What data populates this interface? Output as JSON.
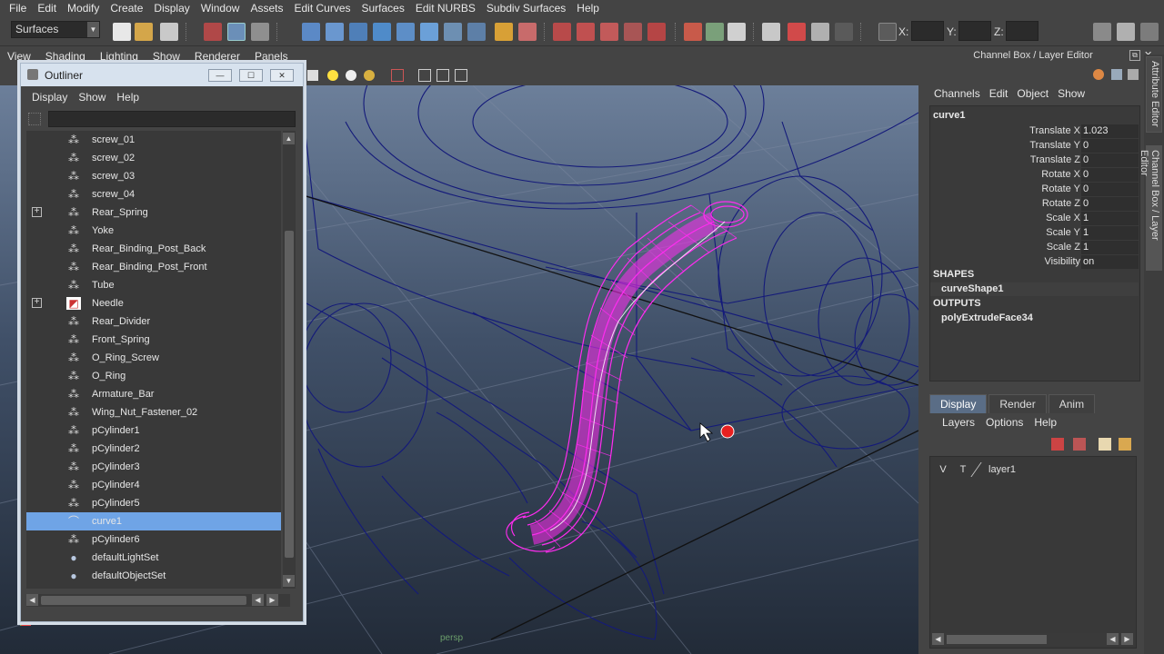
{
  "menubar": [
    "File",
    "Edit",
    "Modify",
    "Create",
    "Display",
    "Window",
    "Assets",
    "Edit Curves",
    "Surfaces",
    "Edit NURBS",
    "Subdiv Surfaces",
    "Help"
  ],
  "shelf": {
    "menu_set": "Surfaces",
    "x_label": "X:",
    "y_label": "Y:",
    "z_label": "Z:"
  },
  "viewport_menu": [
    "View",
    "Shading",
    "Lighting",
    "Show",
    "Renderer",
    "Panels"
  ],
  "viewport_label": "persp",
  "outliner": {
    "title": "Outliner",
    "menu": [
      "Display",
      "Show",
      "Help"
    ],
    "items": [
      {
        "label": "screw_01",
        "icon": "mesh-icon",
        "expand": false,
        "selected": false
      },
      {
        "label": "screw_02",
        "icon": "mesh-icon",
        "expand": false,
        "selected": false
      },
      {
        "label": "screw_03",
        "icon": "mesh-icon",
        "expand": false,
        "selected": false
      },
      {
        "label": "screw_04",
        "icon": "mesh-icon",
        "expand": false,
        "selected": false
      },
      {
        "label": "Rear_Spring",
        "icon": "mesh-icon",
        "expand": true,
        "selected": false
      },
      {
        "label": "Yoke",
        "icon": "mesh-icon",
        "expand": false,
        "selected": false
      },
      {
        "label": "Rear_Binding_Post_Back",
        "icon": "mesh-icon",
        "expand": false,
        "selected": false
      },
      {
        "label": "Rear_Binding_Post_Front",
        "icon": "mesh-icon",
        "expand": false,
        "selected": false
      },
      {
        "label": "Tube",
        "icon": "mesh-icon",
        "expand": false,
        "selected": false
      },
      {
        "label": "Needle",
        "icon": "needle-icon",
        "expand": true,
        "selected": false
      },
      {
        "label": "Rear_Divider",
        "icon": "mesh-icon",
        "expand": false,
        "selected": false
      },
      {
        "label": "Front_Spring",
        "icon": "mesh-icon",
        "expand": false,
        "selected": false
      },
      {
        "label": "O_Ring_Screw",
        "icon": "mesh-icon",
        "expand": false,
        "selected": false
      },
      {
        "label": "O_Ring",
        "icon": "mesh-icon",
        "expand": false,
        "selected": false
      },
      {
        "label": "Armature_Bar",
        "icon": "mesh-icon",
        "expand": false,
        "selected": false
      },
      {
        "label": "Wing_Nut_Fastener_02",
        "icon": "mesh-icon",
        "expand": false,
        "selected": false
      },
      {
        "label": "pCylinder1",
        "icon": "mesh-icon",
        "expand": false,
        "selected": false
      },
      {
        "label": "pCylinder2",
        "icon": "mesh-icon",
        "expand": false,
        "selected": false
      },
      {
        "label": "pCylinder3",
        "icon": "mesh-icon",
        "expand": false,
        "selected": false
      },
      {
        "label": "pCylinder4",
        "icon": "mesh-icon",
        "expand": false,
        "selected": false
      },
      {
        "label": "pCylinder5",
        "icon": "mesh-icon",
        "expand": false,
        "selected": false
      },
      {
        "label": "curve1",
        "icon": "curve-icon",
        "expand": false,
        "selected": true
      },
      {
        "label": "pCylinder6",
        "icon": "mesh-icon",
        "expand": false,
        "selected": false
      },
      {
        "label": "defaultLightSet",
        "icon": "set-icon",
        "expand": false,
        "selected": false
      },
      {
        "label": "defaultObjectSet",
        "icon": "set-icon",
        "expand": false,
        "selected": false
      }
    ]
  },
  "channel_box": {
    "title": "Channel Box / Layer Editor",
    "menu": [
      "Channels",
      "Edit",
      "Object",
      "Show"
    ],
    "object": "curve1",
    "attrs": [
      {
        "label": "Translate X",
        "value": "1.023"
      },
      {
        "label": "Translate Y",
        "value": "0"
      },
      {
        "label": "Translate Z",
        "value": "0"
      },
      {
        "label": "Rotate X",
        "value": "0"
      },
      {
        "label": "Rotate Y",
        "value": "0"
      },
      {
        "label": "Rotate Z",
        "value": "0"
      },
      {
        "label": "Scale X",
        "value": "1"
      },
      {
        "label": "Scale Y",
        "value": "1"
      },
      {
        "label": "Scale Z",
        "value": "1"
      },
      {
        "label": "Visibility",
        "value": "on"
      }
    ],
    "shapes_header": "SHAPES",
    "shape": "curveShape1",
    "outputs_header": "OUTPUTS",
    "output": "polyExtrudeFace34"
  },
  "side_tabs": [
    "Attribute Editor",
    "Channel Box / Layer Editor"
  ],
  "layer_editor": {
    "tabs": [
      "Display",
      "Render",
      "Anim"
    ],
    "menu": [
      "Layers",
      "Options",
      "Help"
    ],
    "layer": {
      "v": "V",
      "t": "T",
      "name": "layer1"
    }
  }
}
